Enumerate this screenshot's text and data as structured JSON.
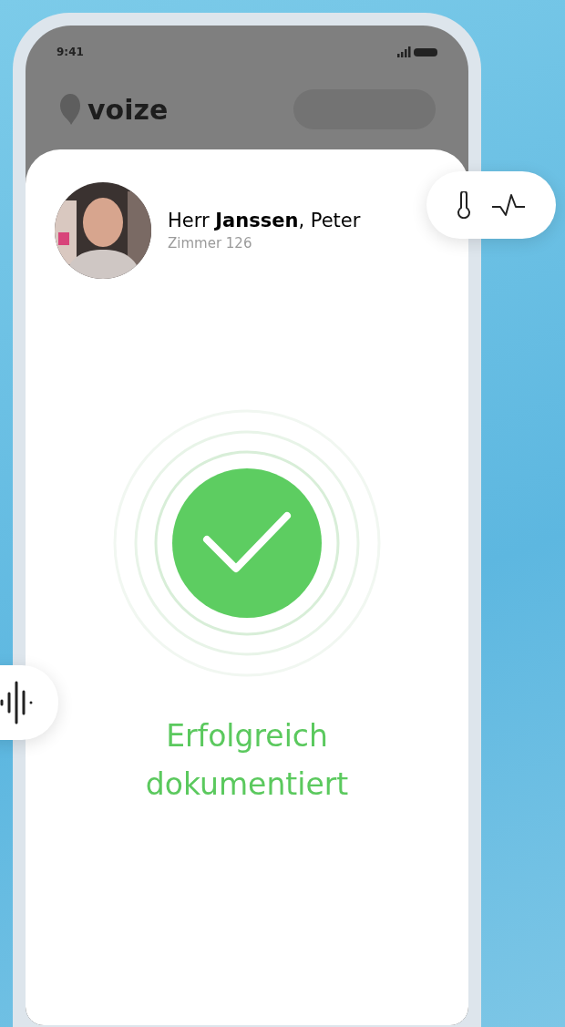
{
  "status_bar": {
    "time": "9:41"
  },
  "header": {
    "logo": "voize"
  },
  "patient": {
    "name": "Herr **Janssen**, Peter",
    "room": "Zimmer 126"
  },
  "result": {
    "message": "Erfolgreich dokumentiert"
  }
}
